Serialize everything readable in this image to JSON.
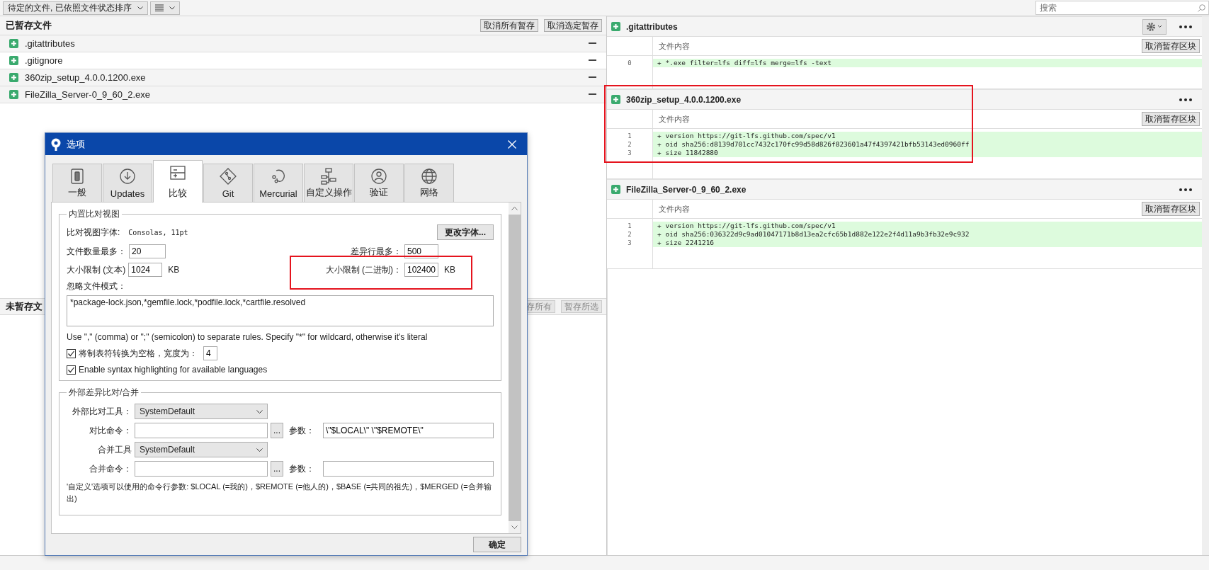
{
  "toolbar": {
    "sort_dropdown": "待定的文件, 已依照文件状态排序"
  },
  "search": {
    "placeholder": "搜索"
  },
  "staged": {
    "title": "已暂存文件",
    "buttons": [
      "取消所有暂存",
      "取消选定暂存"
    ],
    "files": [
      {
        "name": ".gitattributes"
      },
      {
        "name": ".gitignore"
      },
      {
        "name": "360zip_setup_4.0.0.1200.exe"
      },
      {
        "name": "FileZilla_Server-0_9_60_2.exe"
      }
    ]
  },
  "unstaged": {
    "title": "未暂存文",
    "buttons": [
      "存所有",
      "暂存所选"
    ]
  },
  "diffs": [
    {
      "file": ".gitattributes",
      "settings_menu": true,
      "column": "文件内容",
      "button": "取消暂存区块",
      "lines": [
        {
          "number": "0",
          "text": "+ *.exe filter=lfs diff=lfs merge=lfs -text"
        }
      ]
    },
    {
      "file": "360zip_setup_4.0.0.1200.exe",
      "settings_menu": false,
      "column": "文件内容",
      "button": "取消暂存区块",
      "lines": [
        {
          "number": "1",
          "text": "+ version https://git-lfs.github.com/spec/v1"
        },
        {
          "number": "2",
          "text": "+ oid sha256:d8139d701cc7432c170fc99d58d826f823601a47f4397421bfb53143ed0960ff"
        },
        {
          "number": "3",
          "text": "+ size 11842880"
        }
      ]
    },
    {
      "file": "FileZilla_Server-0_9_60_2.exe",
      "settings_menu": false,
      "column": "文件内容",
      "button": "取消暂存区块",
      "lines": [
        {
          "number": "1",
          "text": "+ version https://git-lfs.github.com/spec/v1"
        },
        {
          "number": "2",
          "text": "+ oid sha256:036322d9c9ad01047171b8d13ea2cfc65b1d882e122e2f4d11a9b3fb32e9c932"
        },
        {
          "number": "3",
          "text": "+ size 2241216"
        }
      ]
    }
  ],
  "dialog": {
    "title": "选项",
    "tabs": [
      {
        "label": "一般",
        "selected": false
      },
      {
        "label": "Updates",
        "selected": false
      },
      {
        "label": "比较",
        "selected": true
      },
      {
        "label": "Git",
        "selected": false
      },
      {
        "label": "Mercurial",
        "selected": false
      },
      {
        "label": "自定义操作",
        "selected": false
      },
      {
        "label": "验证",
        "selected": false
      },
      {
        "label": "网络",
        "selected": false
      }
    ],
    "builtin": {
      "title": "内置比对视图",
      "font_label": "比对视图字体:",
      "font_value": "Consolas, 11pt",
      "font_button": "更改字体...",
      "max_files_label": "文件数量最多：",
      "max_files": "20",
      "max_lines_label": "差异行最多：",
      "max_lines": "500",
      "text_limit_label": "大小限制 (文本)",
      "text_limit": "1024",
      "text_unit": "KB",
      "binary_limit_label": "大小限制 (二进制)：",
      "binary_limit": "102400",
      "binary_unit": "KB",
      "ignore_label": "忽略文件模式：",
      "ignore_value": "*package-lock.json,*gemfile.lock,*podfile.lock,*cartfile.resolved",
      "hint": "Use \",\" (comma) or \";\" (semicolon) to separate rules. Specify \"*\" for wildcard, otherwise it's literal",
      "options": [
        {
          "label": "将制表符转换为空格，宽度为：",
          "checked": true,
          "value": "4"
        },
        {
          "label": "Enable syntax highlighting for available languages",
          "checked": true
        }
      ]
    },
    "external": {
      "title": "外部差异比对/合并",
      "diff_tool_label": "外部比对工具：",
      "diff_tool": "SystemDefault",
      "diff_cmd_label": "对比命令：",
      "diff_browse": "...",
      "diff_args_label": "参数：",
      "diff_args": "\\\"$LOCAL\\\" \\\"$REMOTE\\\"",
      "merge_tool_label": "合并工具",
      "merge_tool": "SystemDefault",
      "merge_cmd_label": "合并命令：",
      "merge_browse": "...",
      "merge_args_label": "参数：",
      "note": "'自定义'选项可以使用的命令行参数: $LOCAL (=我的)，$REMOTE (=他人的)，$BASE (=共同的祖先)，$MERGED (=合并输出)"
    },
    "ok": "确定"
  }
}
